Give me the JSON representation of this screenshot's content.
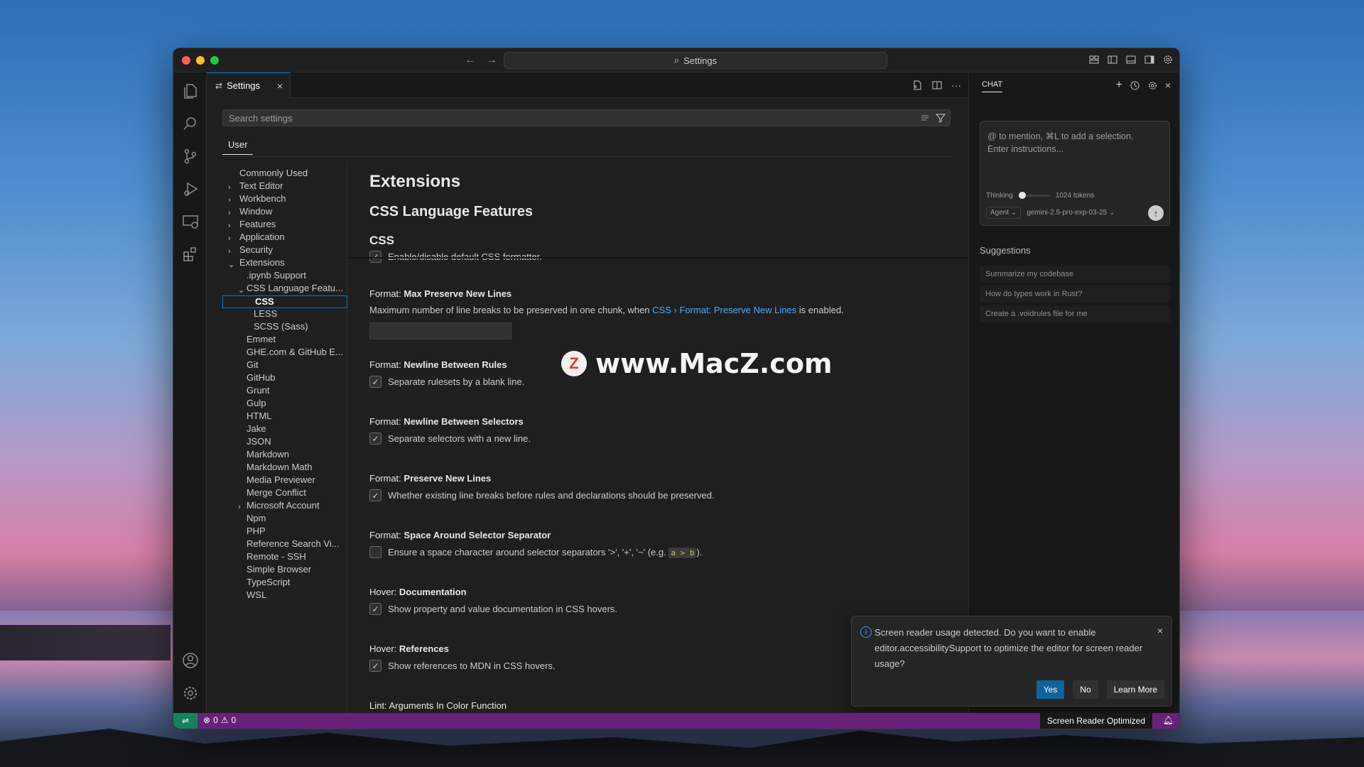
{
  "window": {
    "title": "Settings"
  },
  "tab": {
    "label": "Settings",
    "close": "×"
  },
  "search": {
    "placeholder": "Search settings"
  },
  "scope_tab": "User",
  "toc": [
    {
      "label": "Commonly Used",
      "indent": 0,
      "chevron": ""
    },
    {
      "label": "Text Editor",
      "indent": 0,
      "chevron": "›"
    },
    {
      "label": "Workbench",
      "indent": 0,
      "chevron": "›"
    },
    {
      "label": "Window",
      "indent": 0,
      "chevron": "›"
    },
    {
      "label": "Features",
      "indent": 0,
      "chevron": "›"
    },
    {
      "label": "Application",
      "indent": 0,
      "chevron": "›"
    },
    {
      "label": "Security",
      "indent": 0,
      "chevron": "›"
    },
    {
      "label": "Extensions",
      "indent": 0,
      "chevron": "⌄"
    },
    {
      "label": ".ipynb Support",
      "indent": 1,
      "chevron": ""
    },
    {
      "label": "CSS Language Featu...",
      "indent": 1,
      "chevron": "⌄"
    },
    {
      "label": "CSS",
      "indent": 2,
      "chevron": "",
      "selected": true
    },
    {
      "label": "LESS",
      "indent": 2,
      "chevron": ""
    },
    {
      "label": "SCSS (Sass)",
      "indent": 2,
      "chevron": ""
    },
    {
      "label": "Emmet",
      "indent": 1,
      "chevron": ""
    },
    {
      "label": "GHE.com & GitHub E...",
      "indent": 1,
      "chevron": ""
    },
    {
      "label": "Git",
      "indent": 1,
      "chevron": ""
    },
    {
      "label": "GitHub",
      "indent": 1,
      "chevron": ""
    },
    {
      "label": "Grunt",
      "indent": 1,
      "chevron": ""
    },
    {
      "label": "Gulp",
      "indent": 1,
      "chevron": ""
    },
    {
      "label": "HTML",
      "indent": 1,
      "chevron": ""
    },
    {
      "label": "Jake",
      "indent": 1,
      "chevron": ""
    },
    {
      "label": "JSON",
      "indent": 1,
      "chevron": ""
    },
    {
      "label": "Markdown",
      "indent": 1,
      "chevron": ""
    },
    {
      "label": "Markdown Math",
      "indent": 1,
      "chevron": ""
    },
    {
      "label": "Media Previewer",
      "indent": 1,
      "chevron": ""
    },
    {
      "label": "Merge Conflict",
      "indent": 1,
      "chevron": ""
    },
    {
      "label": "Microsoft Account",
      "indent": 1,
      "chevron": "›"
    },
    {
      "label": "Npm",
      "indent": 1,
      "chevron": ""
    },
    {
      "label": "PHP",
      "indent": 1,
      "chevron": ""
    },
    {
      "label": "Reference Search Vi...",
      "indent": 1,
      "chevron": ""
    },
    {
      "label": "Remote - SSH",
      "indent": 1,
      "chevron": ""
    },
    {
      "label": "Simple Browser",
      "indent": 1,
      "chevron": ""
    },
    {
      "label": "TypeScript",
      "indent": 1,
      "chevron": ""
    },
    {
      "label": "WSL",
      "indent": 1,
      "chevron": ""
    }
  ],
  "content": {
    "h1": "Extensions",
    "h2": "CSS Language Features",
    "h3": "CSS",
    "top_setting_desc": "Enable/disable default CSS formatter.",
    "settings": [
      {
        "prefix": "Format: ",
        "name": "Max Preserve New Lines",
        "desc_a": "Maximum number of line breaks to be preserved in one chunk, when ",
        "link": "CSS › Format: Preserve New Lines",
        "desc_b": " is enabled."
      },
      {
        "prefix": "Format: ",
        "name": "Newline Between Rules",
        "desc": "Separate rulesets by a blank line.",
        "checked": true
      },
      {
        "prefix": "Format: ",
        "name": "Newline Between Selectors",
        "desc": "Separate selectors with a new line.",
        "checked": true
      },
      {
        "prefix": "Format: ",
        "name": "Preserve New Lines",
        "desc": "Whether existing line breaks before rules and declarations should be preserved.",
        "checked": true
      },
      {
        "prefix": "Format: ",
        "name": "Space Around Selector Separator",
        "desc": "Ensure a space character around selector separators '>', '+', '~' (e.g. ",
        "code": "a > b",
        "desc_tail": ").",
        "checked": false
      },
      {
        "prefix": "Hover: ",
        "name": "Documentation",
        "desc": "Show property and value documentation in CSS hovers.",
        "checked": true
      },
      {
        "prefix": "Hover: ",
        "name": "References",
        "desc": "Show references to MDN in CSS hovers.",
        "checked": true
      }
    ],
    "cut_setting": "Lint: Arguments In Color Function"
  },
  "watermark": {
    "logo": "Z",
    "text": "www.MacZ.com"
  },
  "chat": {
    "title": "CHAT",
    "placeholder_line1": "@ to mention, ⌘L to add a selection.",
    "placeholder_line2": "Enter instructions...",
    "thinking_label": "Thinking",
    "thinking_level": 0,
    "tokens": "1024 tokens",
    "mode": "Agent",
    "model": "gemini-2.5-pro-exp-03-25",
    "suggestions_title": "Suggestions",
    "suggestions": [
      "Summarize my codebase",
      "How do types work in Rust?",
      "Create a .voidrules file for me"
    ]
  },
  "toast": {
    "message": "Screen reader usage detected. Do you want to enable editor.accessibilitySupport to optimize the editor for screen reader usage?",
    "yes": "Yes",
    "no": "No",
    "learn_more": "Learn More"
  },
  "statusbar": {
    "errors": "0",
    "warnings": "0",
    "screen_reader": "Screen Reader Optimized"
  },
  "colors": {
    "accent": "#0078d4",
    "statusbar": "#68217a",
    "remote": "#16825d",
    "link": "#4daafc"
  }
}
